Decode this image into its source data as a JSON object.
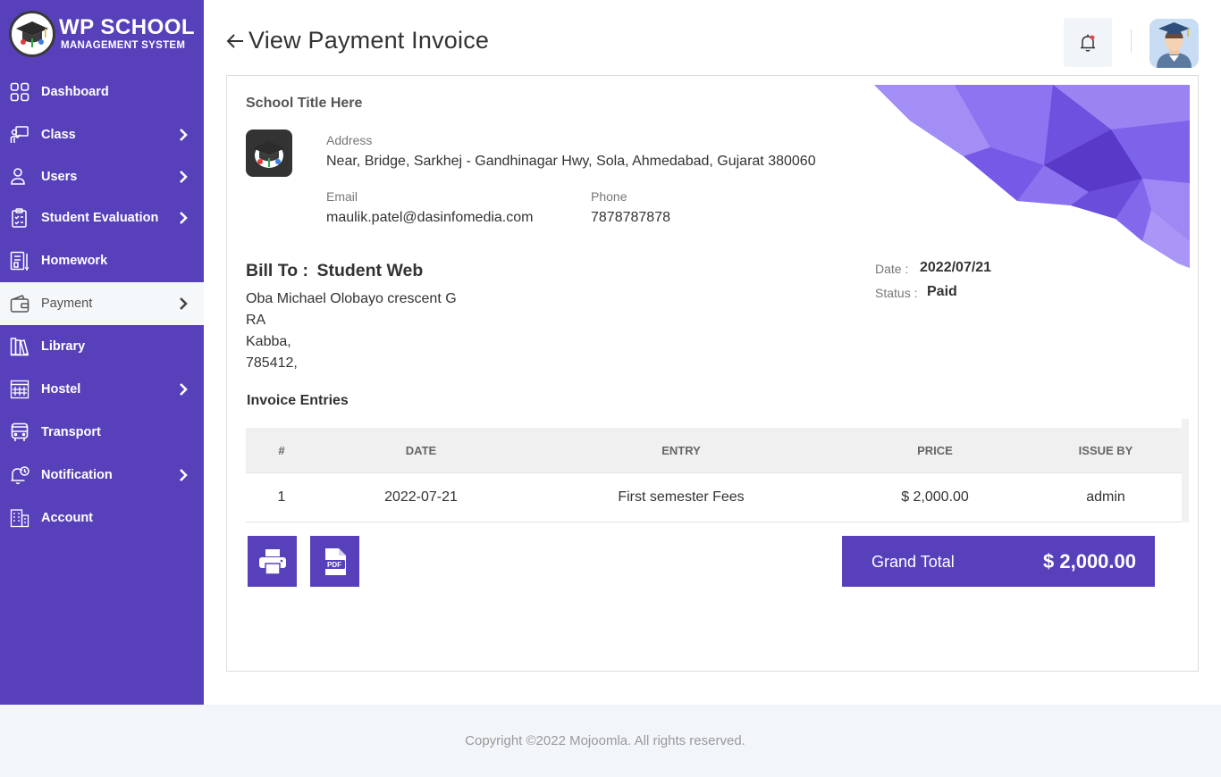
{
  "app": {
    "logo_title": "WP SCHOOL",
    "logo_subtitle": "MANAGEMENT SYSTEM"
  },
  "sidebar": {
    "items": [
      {
        "label": "Dashboard",
        "icon": "grid-icon",
        "has_submenu": false
      },
      {
        "label": "Class",
        "icon": "teacher-board-icon",
        "has_submenu": true
      },
      {
        "label": "Users",
        "icon": "user-icon",
        "has_submenu": true
      },
      {
        "label": "Student Evaluation",
        "icon": "clipboard-icon",
        "has_submenu": true
      },
      {
        "label": "Homework",
        "icon": "notebook-icon",
        "has_submenu": false
      },
      {
        "label": "Payment",
        "icon": "wallet-icon",
        "has_submenu": true,
        "active": true
      },
      {
        "label": "Library",
        "icon": "books-icon",
        "has_submenu": false
      },
      {
        "label": "Hostel",
        "icon": "building-icon",
        "has_submenu": true
      },
      {
        "label": "Transport",
        "icon": "bus-icon",
        "has_submenu": false
      },
      {
        "label": "Notification",
        "icon": "bell-clock-icon",
        "has_submenu": true
      },
      {
        "label": "Account",
        "icon": "office-icon",
        "has_submenu": false
      }
    ]
  },
  "header": {
    "title": "View Payment Invoice",
    "back_icon": "arrow-left-icon",
    "notification_icon": "bell-icon"
  },
  "invoice": {
    "school_title": "School Title Here",
    "address_label": "Address",
    "address_value": "Near, Bridge, Sarkhej - Gandhinagar Hwy, Sola, Ahmedabad, Gujarat 380060",
    "email_label": "Email",
    "email_value": "maulik.patel@dasinfomedia.com",
    "phone_label": "Phone",
    "phone_value": "7878787878",
    "bill_to_label": "Bill To :",
    "bill_to_name": "Student Web",
    "bill_address": [
      "Oba Michael Olobayo crescent G",
      "RA",
      "Kabba,",
      "785412,"
    ],
    "date_label": "Date :",
    "date_value": "2022/07/21",
    "status_label": "Status :",
    "status_value": "Paid",
    "entries_title": "Invoice Entries",
    "table": {
      "headers": [
        "#",
        "DATE",
        "ENTRY",
        "PRICE",
        "ISSUE BY"
      ],
      "rows": [
        [
          "1",
          "2022-07-21",
          "First semester Fees",
          "$ 2,000.00",
          "admin"
        ]
      ]
    },
    "grand_total_label": "Grand Total",
    "grand_total_value": "$ 2,000.00",
    "accent_color": "#5840bb"
  },
  "footer": {
    "copyright": "Copyright ©2022 Mojoomla. All rights reserved."
  }
}
